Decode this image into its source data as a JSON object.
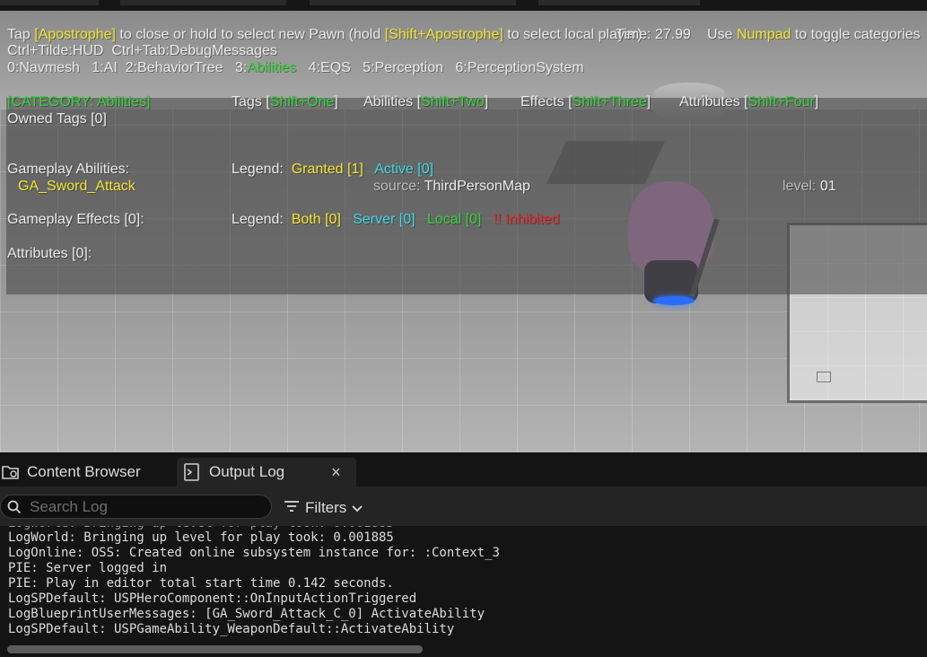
{
  "debug": {
    "line1": {
      "p1": "Tap ",
      "k1": "[Apostrophe]",
      "p2": " to close or hold to select new Pawn (hold ",
      "k2": "[Shift+Apostrophe]",
      "p3": " to select local player)",
      "time": "Time: 27.99",
      "p4": "Use ",
      "k3": "Numpad",
      "p5": " to toggle categories"
    },
    "line2": {
      "hud_key": "Ctrl+Tilde",
      "hud_label": ":HUD",
      "dbg_key": "Ctrl+Tab",
      "dbg_label": ":DebugMessages"
    },
    "categories": [
      {
        "num": "0",
        "name": "Navmesh"
      },
      {
        "num": "1",
        "name": "AI"
      },
      {
        "num": "2",
        "name": "BehaviorTree"
      },
      {
        "num": "3",
        "name": "Abilities"
      },
      {
        "num": "4",
        "name": "EQS"
      },
      {
        "num": "5",
        "name": "Perception"
      },
      {
        "num": "6",
        "name": "PerceptionSystem"
      }
    ],
    "category_header": "[CATEGORY: Abilities]",
    "tags": {
      "label": "Tags [",
      "key": "Shift+One",
      "end": "]"
    },
    "abilities_toggle": {
      "label": "Abilities [",
      "key": "Shift+Two",
      "end": "]"
    },
    "effects_toggle": {
      "label": "Effects [",
      "key": "Shift+Three",
      "end": "]"
    },
    "attributes_toggle": {
      "label": "Attributes [",
      "key": "Shift+Four",
      "end": "]"
    },
    "owned_tags": "Owned Tags [0]",
    "gameplay_abilities": "Gameplay Abilities:",
    "legend_label": "Legend:",
    "granted": "Granted [1]",
    "active": "Active [0]",
    "ability_name": "GA_Sword_Attack",
    "source_label": "source:",
    "source_value": "ThirdPersonMap",
    "level_label": "level:",
    "level_value": "01",
    "gameplay_effects": "Gameplay Effects [0]:",
    "both": "Both [0]",
    "server": "Server [0]",
    "local": "Local [0]",
    "inhibited": "!! Inhibited",
    "attributes": "Attributes [0]:"
  },
  "tabs": [
    {
      "label": "Content Browser",
      "icon": "folder-icon"
    },
    {
      "label": "Output Log",
      "icon": "terminal-icon",
      "close": "×"
    }
  ],
  "search": {
    "placeholder": "Search Log"
  },
  "filters": {
    "label": "Filters"
  },
  "log_lines": [
    "LogWorld: Bringing up level for play took: 0.001885",
    "LogOnline: OSS: Created online subsystem instance for: :Context_3",
    "PIE: Server logged in",
    "PIE: Play in editor total start time 0.142 seconds.",
    "LogSPDefault: USPHeroComponent::OnInputActionTriggered",
    "LogBlueprintUserMessages: [GA_Sword_Attack_C_0] ActivateAbility",
    "LogSPDefault: USPGameAbility_WeaponDefault::ActivateAbility"
  ]
}
